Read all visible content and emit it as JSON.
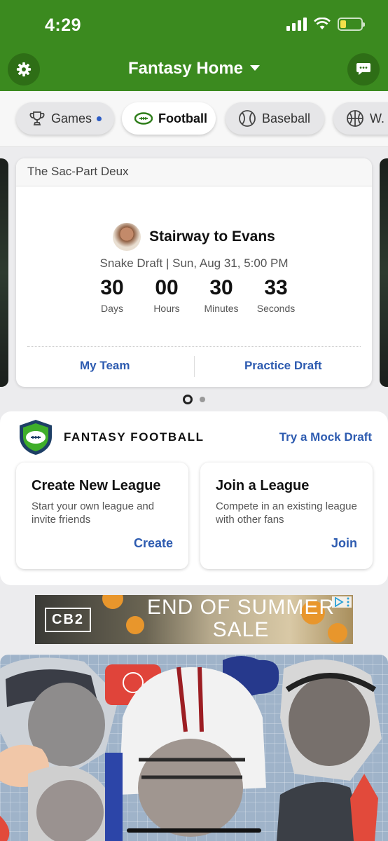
{
  "status_bar": {
    "time": "4:29"
  },
  "header": {
    "title": "Fantasy Home"
  },
  "sport_tabs": [
    {
      "label": "Games",
      "icon": "trophy-icon",
      "badge": true
    },
    {
      "label": "Football",
      "icon": "football-icon",
      "active": true
    },
    {
      "label": "Baseball",
      "icon": "baseball-icon"
    },
    {
      "label": "W. B",
      "icon": "basketball-icon"
    }
  ],
  "draft_card": {
    "league_name": "The Sac-Part Deux",
    "team_name": "Stairway to Evans",
    "draft_info": "Snake Draft | Sun, Aug 31, 5:00 PM",
    "countdown": [
      {
        "value": "30",
        "label": "Days"
      },
      {
        "value": "00",
        "label": "Hours"
      },
      {
        "value": "30",
        "label": "Minutes"
      },
      {
        "value": "33",
        "label": "Seconds"
      }
    ],
    "my_team_label": "My Team",
    "practice_draft_label": "Practice Draft"
  },
  "pager": {
    "pages": 2,
    "active": 0
  },
  "fantasy_football": {
    "title": "FANTASY FOOTBALL",
    "mock_draft_label": "Try a Mock Draft",
    "create": {
      "title": "Create New League",
      "description": "Start your own league and invite friends",
      "action": "Create"
    },
    "join": {
      "title": "Join a League",
      "description": "Compete in an existing league with other fans",
      "action": "Join"
    }
  },
  "ad": {
    "brand": "CB2",
    "text": "END OF SUMMER SALE"
  },
  "colors": {
    "header_green": "#3b8a1f",
    "link_blue": "#2d5bb0",
    "badge_blue": "#2c5cc5"
  }
}
